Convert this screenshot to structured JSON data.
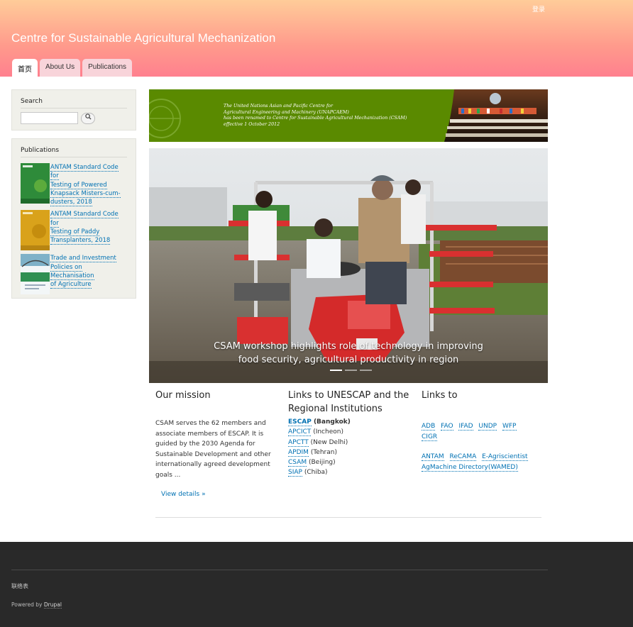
{
  "header": {
    "login": "登录",
    "site_name": "Centre for Sustainable Agricultural Mechanization",
    "tabs": [
      {
        "label": "首页",
        "active": true
      },
      {
        "label": "About Us",
        "active": false
      },
      {
        "label": "Publications",
        "active": false
      }
    ]
  },
  "sidebar": {
    "search": {
      "title": "Search",
      "placeholder": "",
      "button_icon": "search-icon"
    },
    "publications": {
      "title": "Publications",
      "items": [
        {
          "line1": "ANTAM Standard Code for",
          "line2": "Testing of Powered",
          "line3": "Knapsack Misters-cum-",
          "line4": "dusters, 2018",
          "cover_color": "#2e8b3a"
        },
        {
          "line1": "ANTAM Standard Code for",
          "line2": "Testing of Paddy",
          "line3": "Transplanters, 2018",
          "line4": "",
          "cover_color": "#d9a21b"
        },
        {
          "line1": "Trade and Investment",
          "line2": "Policies on Mechanisation",
          "line3": "of Agriculture",
          "line4": "",
          "cover_color": "#e8f0f4"
        }
      ]
    }
  },
  "banner": {
    "line1": "The United Nations Asian and Pacific Centre for",
    "line2": "Agricultural Engineering and Machinery (UNAPCAEM)",
    "line3": "has been renamed to Centre for Sustainable Agricultural Mechanization (CSAM)",
    "line4": "effective 1 October 2012"
  },
  "slideshow": {
    "caption_line1": "CSAM workshop highlights role of technology in improving",
    "caption_line2": "food security, agricultural productivity in region",
    "active_slide": 1
  },
  "mission": {
    "title": "Our mission",
    "text": "CSAM serves the 62 members and associate members of ESCAP. It is guided by the 2030 Agenda for Sustainable Development and other internationally agreed development goals ...",
    "details": "View details »"
  },
  "unescap": {
    "title": "Links to UNESCAP and the Regional Institutions",
    "links": [
      {
        "name": "ESCAP",
        "city": "(Bangkok)"
      },
      {
        "name": "APCICT",
        "city": "(Incheon)"
      },
      {
        "name": "APCTT",
        "city": "(New Delhi)"
      },
      {
        "name": "APDIM",
        "city": "(Tehran)"
      },
      {
        "name": "CSAM",
        "city": "(Beijing)"
      },
      {
        "name": "SIAP",
        "city": "(Chiba)"
      }
    ]
  },
  "links_to": {
    "title": "Links to",
    "row1": [
      "ADB",
      "FAO",
      "IFAD",
      "UNDP",
      "WFP",
      "CIGR"
    ],
    "row2": [
      "ANTAM",
      "ReCAMA",
      "E-Agriscientist",
      "AgMachine Directory(WAMED)"
    ]
  },
  "footer": {
    "contact": "联络表",
    "powered_prefix": "Powered by",
    "powered_name": "Drupal"
  }
}
